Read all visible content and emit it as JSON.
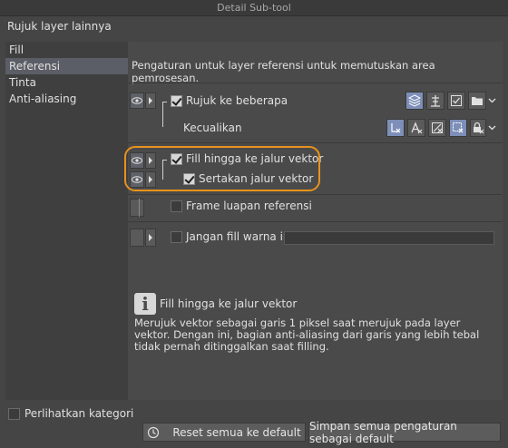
{
  "window": {
    "title": "Detail Sub-tool"
  },
  "preset_label": "Rujuk layer lainnya",
  "sidebar": {
    "items": [
      {
        "label": "Fill",
        "active": false
      },
      {
        "label": "Referensi",
        "active": true
      },
      {
        "label": "Tinta",
        "active": false
      },
      {
        "label": "Anti-aliasing",
        "active": false
      }
    ],
    "show_category_label": "Perlihatkan kategori",
    "show_category_checked": false
  },
  "main": {
    "description": "Pengaturan untuk layer referensi untuk memutuskan area pemrosesan.",
    "rows": {
      "refer_multiple": {
        "label": "Rujuk ke beberapa",
        "checked": true
      },
      "exclude": {
        "label": "Kecualikan"
      },
      "fill_to_vector": {
        "label": "Fill hingga ke jalur vektor",
        "checked": true
      },
      "include_vector": {
        "label": "Sertakan jalur vektor",
        "checked": true
      },
      "frame_reference": {
        "label": "Frame luapan referensi",
        "checked": false
      },
      "no_fill_color": {
        "label": "Jangan fill warna ini",
        "checked": false
      }
    },
    "icons": {
      "refer_multiple": [
        "all-layers-icon",
        "reference-layer-icon",
        "selected-layer-icon",
        "folder-icon"
      ],
      "exclude": [
        "exclude-draft-icon",
        "exclude-text-icon",
        "exclude-edit-icon",
        "exclude-selection-icon",
        "exclude-lock-icon"
      ]
    }
  },
  "info": {
    "title": "Fill hingga ke jalur vektor",
    "text": "Merujuk vektor sebagai garis 1 piksel saat merujuk pada layer vektor. Dengan ini, bagian anti-aliasing dari garis yang lebih tebal tidak pernah ditinggalkan saat filling."
  },
  "buttons": {
    "reset": "Reset semua ke default",
    "save": "Simpan semua pengaturan sebagai default"
  },
  "colors": {
    "highlight": "#e8921c",
    "active_icon": "#7d8fb8",
    "background": "#454545"
  }
}
